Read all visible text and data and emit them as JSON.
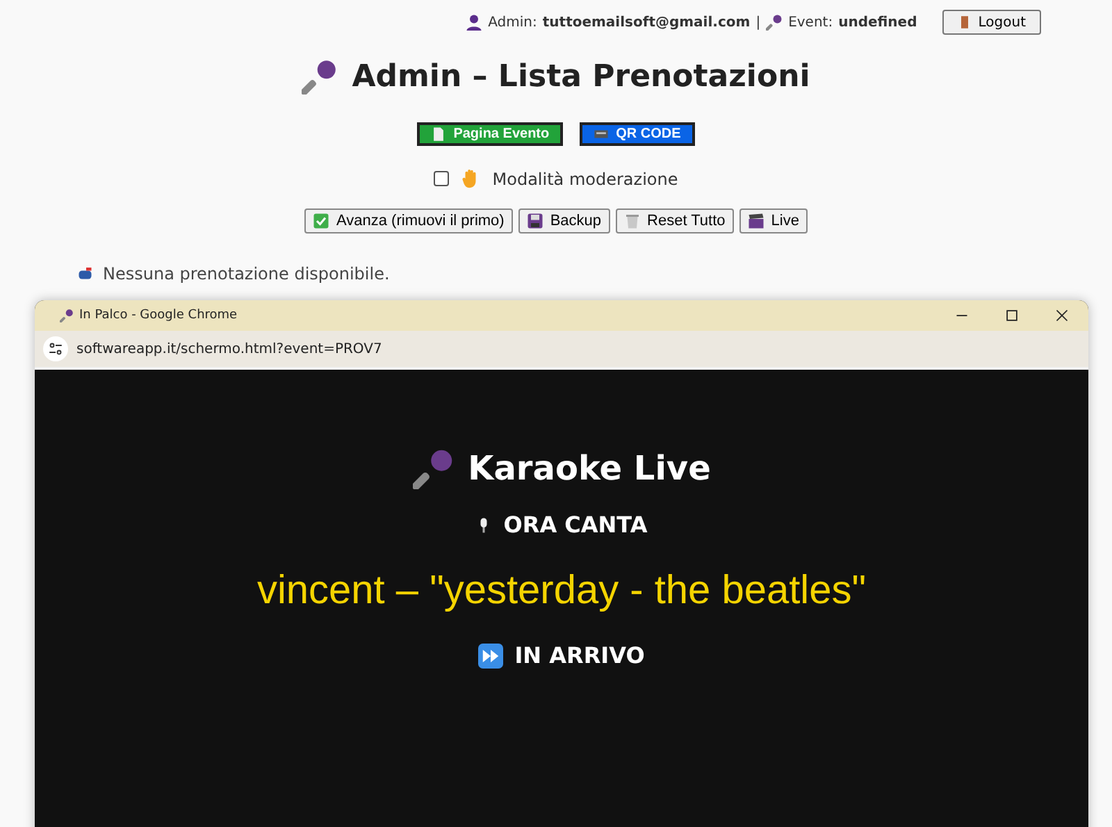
{
  "header": {
    "admin_label": "Admin:",
    "admin_email": "tuttoemailsoft@gmail.com",
    "separator": "|",
    "event_label": "Event:",
    "event_value": "undefined",
    "logout": "Logout"
  },
  "title": "Admin – Lista Prenotazioni",
  "link_buttons": [
    {
      "label": "Pagina Evento",
      "color": "#22a33a",
      "kind": "page"
    },
    {
      "label": "QR CODE",
      "color": "#0a64e6",
      "kind": "qr"
    }
  ],
  "moderation": {
    "label": "Modalità moderazione",
    "checked": false
  },
  "actions": [
    {
      "label": "Avanza (rimuovi il primo)",
      "kind": "check"
    },
    {
      "label": "Backup",
      "kind": "save"
    },
    {
      "label": "Reset Tutto",
      "kind": "trash"
    },
    {
      "label": "Live",
      "kind": "film"
    }
  ],
  "empty_message": "Nessuna prenotazione disponibile.",
  "browser": {
    "title": "In Palco - Google Chrome",
    "url": "softwareapp.it/schermo.html?event=PROV7",
    "heading": "Karaoke Live",
    "now_label": "ORA CANTA",
    "now_singing": "vincent – \"yesterday - the beatles\"",
    "next_label": "IN ARRIVO"
  }
}
